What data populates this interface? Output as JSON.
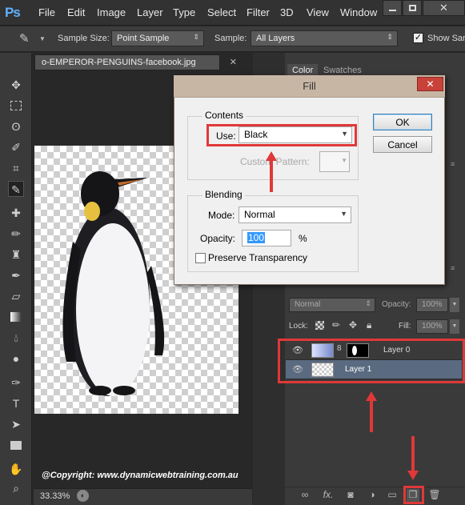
{
  "app": {
    "logo": "Ps"
  },
  "menu": [
    "File",
    "Edit",
    "Image",
    "Layer",
    "Type",
    "Select",
    "Filter",
    "3D",
    "View",
    "Window"
  ],
  "options_bar": {
    "sample_size_label": "Sample Size:",
    "sample_size_value": "Point Sample",
    "sample_label": "Sample:",
    "sample_value": "All Layers",
    "show_sampling_label": "Show San"
  },
  "document": {
    "tab_title": "o-EMPEROR-PENGUINS-facebook.jpg",
    "copyright": "@Copyright: www.dynamicwebtraining.com.au",
    "zoom": "33.33%"
  },
  "panels": {
    "tabs": [
      "Color",
      "Swatches"
    ],
    "blend_mode": "Normal",
    "opacity_label": "Opacity:",
    "opacity_value": "100%",
    "lock_label": "Lock:",
    "fill_label": "Fill:",
    "fill_value": "100%",
    "layers": [
      {
        "name": "Layer 0"
      },
      {
        "name": "Layer 1"
      }
    ]
  },
  "dialog": {
    "title": "Fill",
    "contents_label": "Contents",
    "use_label": "Use:",
    "use_value": "Black",
    "custom_pattern_label": "Custom Pattern:",
    "blending_label": "Blending",
    "mode_label": "Mode:",
    "mode_value": "Normal",
    "opacity_label": "Opacity:",
    "opacity_value": "100",
    "opacity_unit": "%",
    "preserve_label": "Preserve Transparency",
    "ok_label": "OK",
    "cancel_label": "Cancel",
    "close_icon": "close-icon"
  },
  "colors": {
    "highlight": "#e03838",
    "ps_blue": "#5fb3ff",
    "dialog_title_bg": "#c8b6a4"
  }
}
